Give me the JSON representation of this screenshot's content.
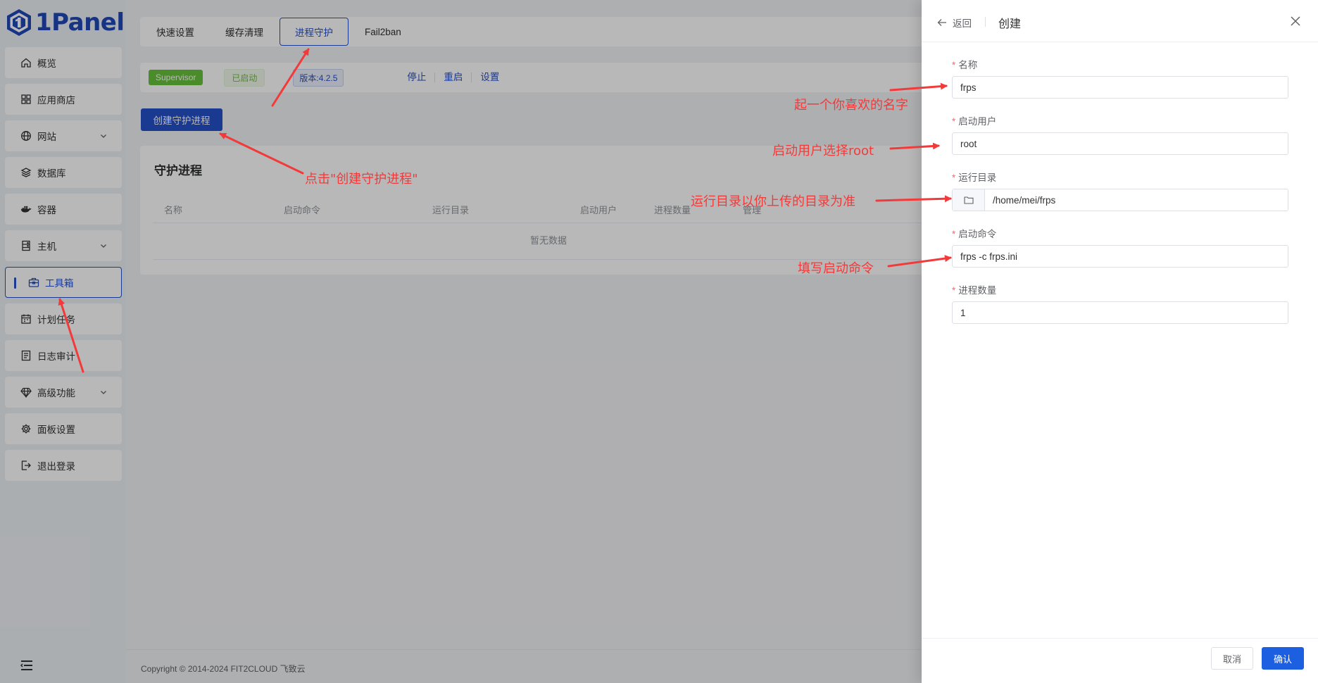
{
  "brand": {
    "name": "1Panel"
  },
  "sidebar": {
    "items": [
      {
        "label": "概览",
        "icon": "home-icon"
      },
      {
        "label": "应用商店",
        "icon": "grid-icon"
      },
      {
        "label": "网站",
        "icon": "globe-icon"
      },
      {
        "label": "数据库",
        "icon": "layers-icon"
      },
      {
        "label": "容器",
        "icon": "docker-icon"
      },
      {
        "label": "主机",
        "icon": "server-icon"
      },
      {
        "label": "工具箱",
        "icon": "toolbox-icon"
      },
      {
        "label": "计划任务",
        "icon": "calendar-icon"
      },
      {
        "label": "日志审计",
        "icon": "log-icon"
      },
      {
        "label": "高级功能",
        "icon": "diamond-icon"
      },
      {
        "label": "面板设置",
        "icon": "gear-icon"
      },
      {
        "label": "退出登录",
        "icon": "logout-icon"
      }
    ],
    "active": "工具箱"
  },
  "tabs": [
    "快速设置",
    "缓存清理",
    "进程守护",
    "Fail2ban"
  ],
  "active_tab": "进程守护",
  "status": {
    "service": "Supervisor",
    "state": "已启动",
    "version": "版本:4.2.5",
    "actions": [
      "停止",
      "重启",
      "设置"
    ]
  },
  "create_button": "创建守护进程",
  "table": {
    "title": "守护进程",
    "columns": [
      "名称",
      "启动命令",
      "运行目录",
      "启动用户",
      "进程数量",
      "管理"
    ],
    "empty_text": "暂无数据"
  },
  "footer": {
    "copyright": "Copyright © 2014-2024 FIT2CLOUD 飞致云"
  },
  "drawer": {
    "back_label": "返回",
    "title": "创建",
    "fields": {
      "name": {
        "label": "名称",
        "value": "frps"
      },
      "user": {
        "label": "启动用户",
        "value": "root"
      },
      "dir": {
        "label": "运行目录",
        "value": "/home/mei/frps"
      },
      "command": {
        "label": "启动命令",
        "value": "frps -c frps.ini"
      },
      "count": {
        "label": "进程数量",
        "value": "1"
      }
    },
    "cancel_label": "取消",
    "confirm_label": "确认"
  },
  "annotations": {
    "click_create": "点击\"创建守护进程\"",
    "name_hint": "起一个你喜欢的名字",
    "user_hint": "启动用户选择root",
    "dir_hint": "运行目录以你上传的目录为准",
    "cmd_hint": "填写启动命令",
    "color": "#f23a3a"
  }
}
